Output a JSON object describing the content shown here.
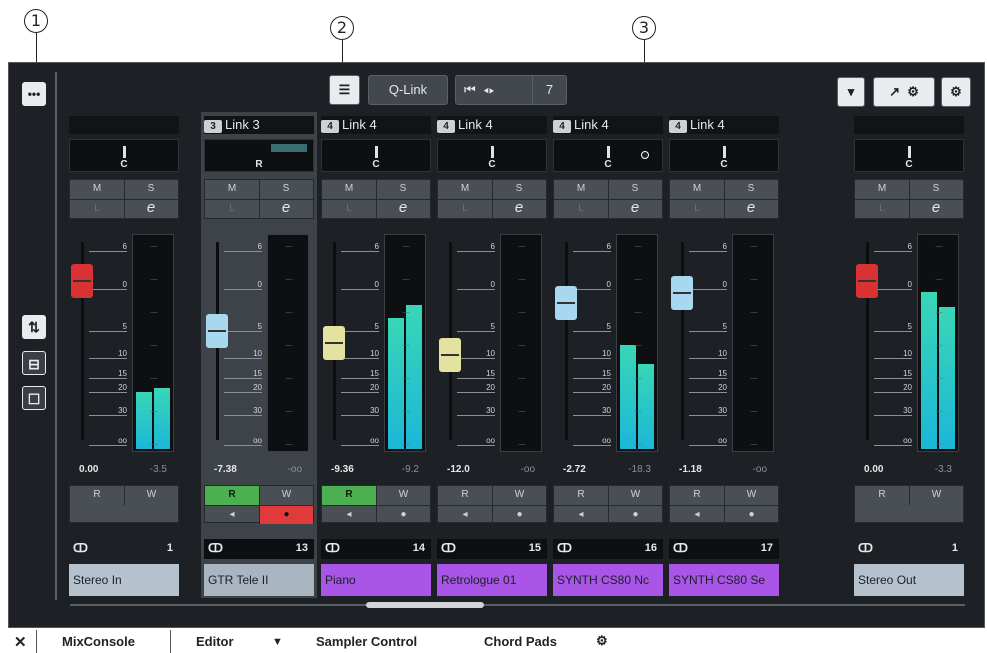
{
  "callouts": [
    "1",
    "2",
    "3"
  ],
  "toolbar": {
    "qlink": "Q-Link",
    "link_count": "7"
  },
  "channels": [
    {
      "link": "",
      "pan": "C",
      "m": "M",
      "s": "S",
      "l": "L",
      "e": "e",
      "fader": "0.00",
      "peak": "-3.5",
      "read": "R",
      "write": "W",
      "number": "1",
      "name": "Stereo In",
      "fader_color": "#d83232",
      "name_bg": "#b5c1cc",
      "meter_l": 0.27,
      "meter_r": 0.29
    },
    {
      "link": "Link 3",
      "link_badge": "3",
      "pan": "R",
      "m": "M",
      "s": "S",
      "l": "L",
      "e": "e",
      "fader": "-7.38",
      "peak": "-oo",
      "read": "R",
      "write": "W",
      "number": "13",
      "name": "GTR Tele II",
      "fader_color": "#a8d8f0",
      "name_bg": "#a9b6c2",
      "meter_l": 0,
      "meter_r": 0
    },
    {
      "link": "Link 4",
      "link_badge": "4",
      "pan": "C",
      "m": "M",
      "s": "S",
      "l": "L",
      "e": "e",
      "fader": "-9.36",
      "peak": "-9.2",
      "read": "R",
      "write": "W",
      "number": "14",
      "name": "Piano",
      "fader_color": "#e4e2a0",
      "name_bg": "#a855e8",
      "meter_l": 0.62,
      "meter_r": 0.68
    },
    {
      "link": "Link 4",
      "link_badge": "4",
      "pan": "C",
      "m": "M",
      "s": "S",
      "l": "L",
      "e": "e",
      "fader": "-12.0",
      "peak": "-oo",
      "read": "R",
      "write": "W",
      "number": "15",
      "name": "Retrologue 01",
      "fader_color": "#e4e2a0",
      "name_bg": "#a855e8",
      "meter_l": 0,
      "meter_r": 0
    },
    {
      "link": "Link 4",
      "link_badge": "4",
      "pan": "C",
      "m": "M",
      "s": "S",
      "l": "L",
      "e": "e",
      "fader": "-2.72",
      "peak": "-18.3",
      "read": "R",
      "write": "W",
      "number": "16",
      "name": "SYNTH CS80 Nc",
      "fader_color": "#a8d8f0",
      "name_bg": "#a855e8",
      "meter_l": 0.49,
      "meter_r": 0.4
    },
    {
      "link": "Link 4",
      "link_badge": "4",
      "pan": "C",
      "m": "M",
      "s": "S",
      "l": "L",
      "e": "e",
      "fader": "-1.18",
      "peak": "-oo",
      "read": "R",
      "write": "W",
      "number": "17",
      "name": "SYNTH CS80 Se",
      "fader_color": "#a8d8f0",
      "name_bg": "#a855e8",
      "meter_l": 0,
      "meter_r": 0
    },
    {
      "link": "",
      "pan": "C",
      "m": "M",
      "s": "S",
      "l": "L",
      "e": "e",
      "fader": "0.00",
      "peak": "-3.3",
      "read": "R",
      "write": "W",
      "number": "1",
      "name": "Stereo Out",
      "fader_color": "#d83232",
      "name_bg": "#b5c1cc",
      "meter_l": 0.74,
      "meter_r": 0.67
    }
  ],
  "scale_labels": [
    "6",
    "0",
    "5",
    "10",
    "15",
    "20",
    "30",
    "oo"
  ],
  "tabs": {
    "mix": "MixConsole",
    "editor": "Editor",
    "sampler": "Sampler Control",
    "chord": "Chord Pads"
  },
  "colors": {
    "background": "#1d2024",
    "accent_meter": "#1bb7d8",
    "read_active": "#4caf50",
    "record_active": "#e03a3a"
  }
}
